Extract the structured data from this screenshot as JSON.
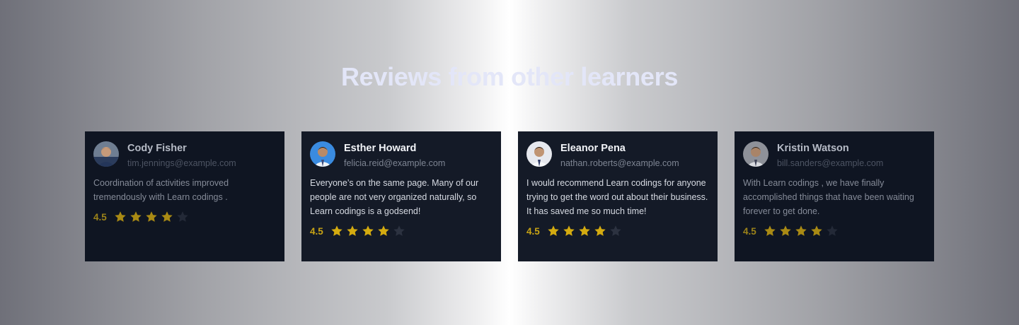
{
  "heading": "Reviews from other learners",
  "colors": {
    "star_filled": "#d4ab10",
    "star_empty": "#2c3240",
    "card_bg": "#141a27"
  },
  "reviews": [
    {
      "name": "Cody Fisher",
      "email": "tim.jennings@example.com",
      "text": "Coordination of activities improved tremendously with Learn codings .",
      "rating": "4.5",
      "stars_filled": 4,
      "stars_total": 5,
      "avatar": "avatar-photo"
    },
    {
      "name": "Esther Howard",
      "email": "felicia.reid@example.com",
      "text": "Everyone’s on the same page. Many of our people are not very organized naturally, so Learn codings is a godsend!",
      "rating": "4.5",
      "stars_filled": 4,
      "stars_total": 5,
      "avatar": "avatar-photo"
    },
    {
      "name": "Eleanor Pena",
      "email": "nathan.roberts@example.com",
      "text": "I would recommend Learn codings for anyone trying to get the word out about their business. It has saved me so much time!",
      "rating": "4.5",
      "stars_filled": 4,
      "stars_total": 5,
      "avatar": "avatar-photo"
    },
    {
      "name": "Kristin Watson",
      "email": "bill.sanders@example.com",
      "text": "With Learn codings , we have finally accomplished things that have been waiting forever to get done.",
      "rating": "4.5",
      "stars_filled": 4,
      "stars_total": 5,
      "avatar": "avatar-photo"
    }
  ]
}
